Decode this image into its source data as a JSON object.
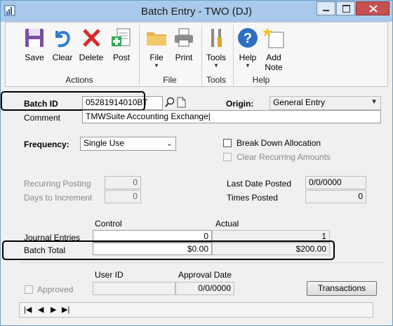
{
  "window": {
    "title": "Batch Entry  -  TWO (DJ)"
  },
  "ribbon": {
    "groups": [
      {
        "label": "Actions",
        "buttons": [
          "Save",
          "Clear",
          "Delete",
          "Post"
        ]
      },
      {
        "label": "File",
        "buttons": [
          "File",
          "Print"
        ]
      },
      {
        "label": "Tools",
        "buttons": [
          "Tools"
        ]
      },
      {
        "label": "Help",
        "buttons": [
          "Help",
          "Add",
          "Note"
        ]
      }
    ]
  },
  "form": {
    "batch_id_label": "Batch ID",
    "batch_id_value": "05281914010BT",
    "origin_label": "Origin:",
    "origin_value": "General Entry",
    "comment_label": "Comment",
    "comment_value": "TMWSuite Accounting Exchange|",
    "frequency_label": "Frequency:",
    "frequency_value": "Single Use",
    "break_down_label": "Break Down Allocation",
    "clear_recurring_label": "Clear Recurring Amounts",
    "recurring_posting_label": "Recurring Posting",
    "recurring_posting_value": "0",
    "days_to_increment_label": "Days to Increment",
    "days_to_increment_value": "0",
    "last_date_posted_label": "Last Date Posted",
    "last_date_posted_value": "0/0/0000",
    "times_posted_label": "Times Posted",
    "times_posted_value": "0",
    "control_header": "Control",
    "actual_header": "Actual",
    "journal_entries_label": "Journal Entries",
    "journal_entries_control": "0",
    "journal_entries_actual": "1",
    "batch_total_label": "Batch Total",
    "batch_total_control": "$0.00",
    "batch_total_actual": "$200.00",
    "user_id_label": "User ID",
    "approval_date_label": "Approval Date",
    "approved_label": "Approved",
    "user_id_value": "",
    "approval_date_value": "0/0/0000",
    "transactions_button": "Transactions"
  },
  "nav": {
    "first": "first-record",
    "prev": "previous-record",
    "next": "next-record",
    "last": "last-record"
  }
}
